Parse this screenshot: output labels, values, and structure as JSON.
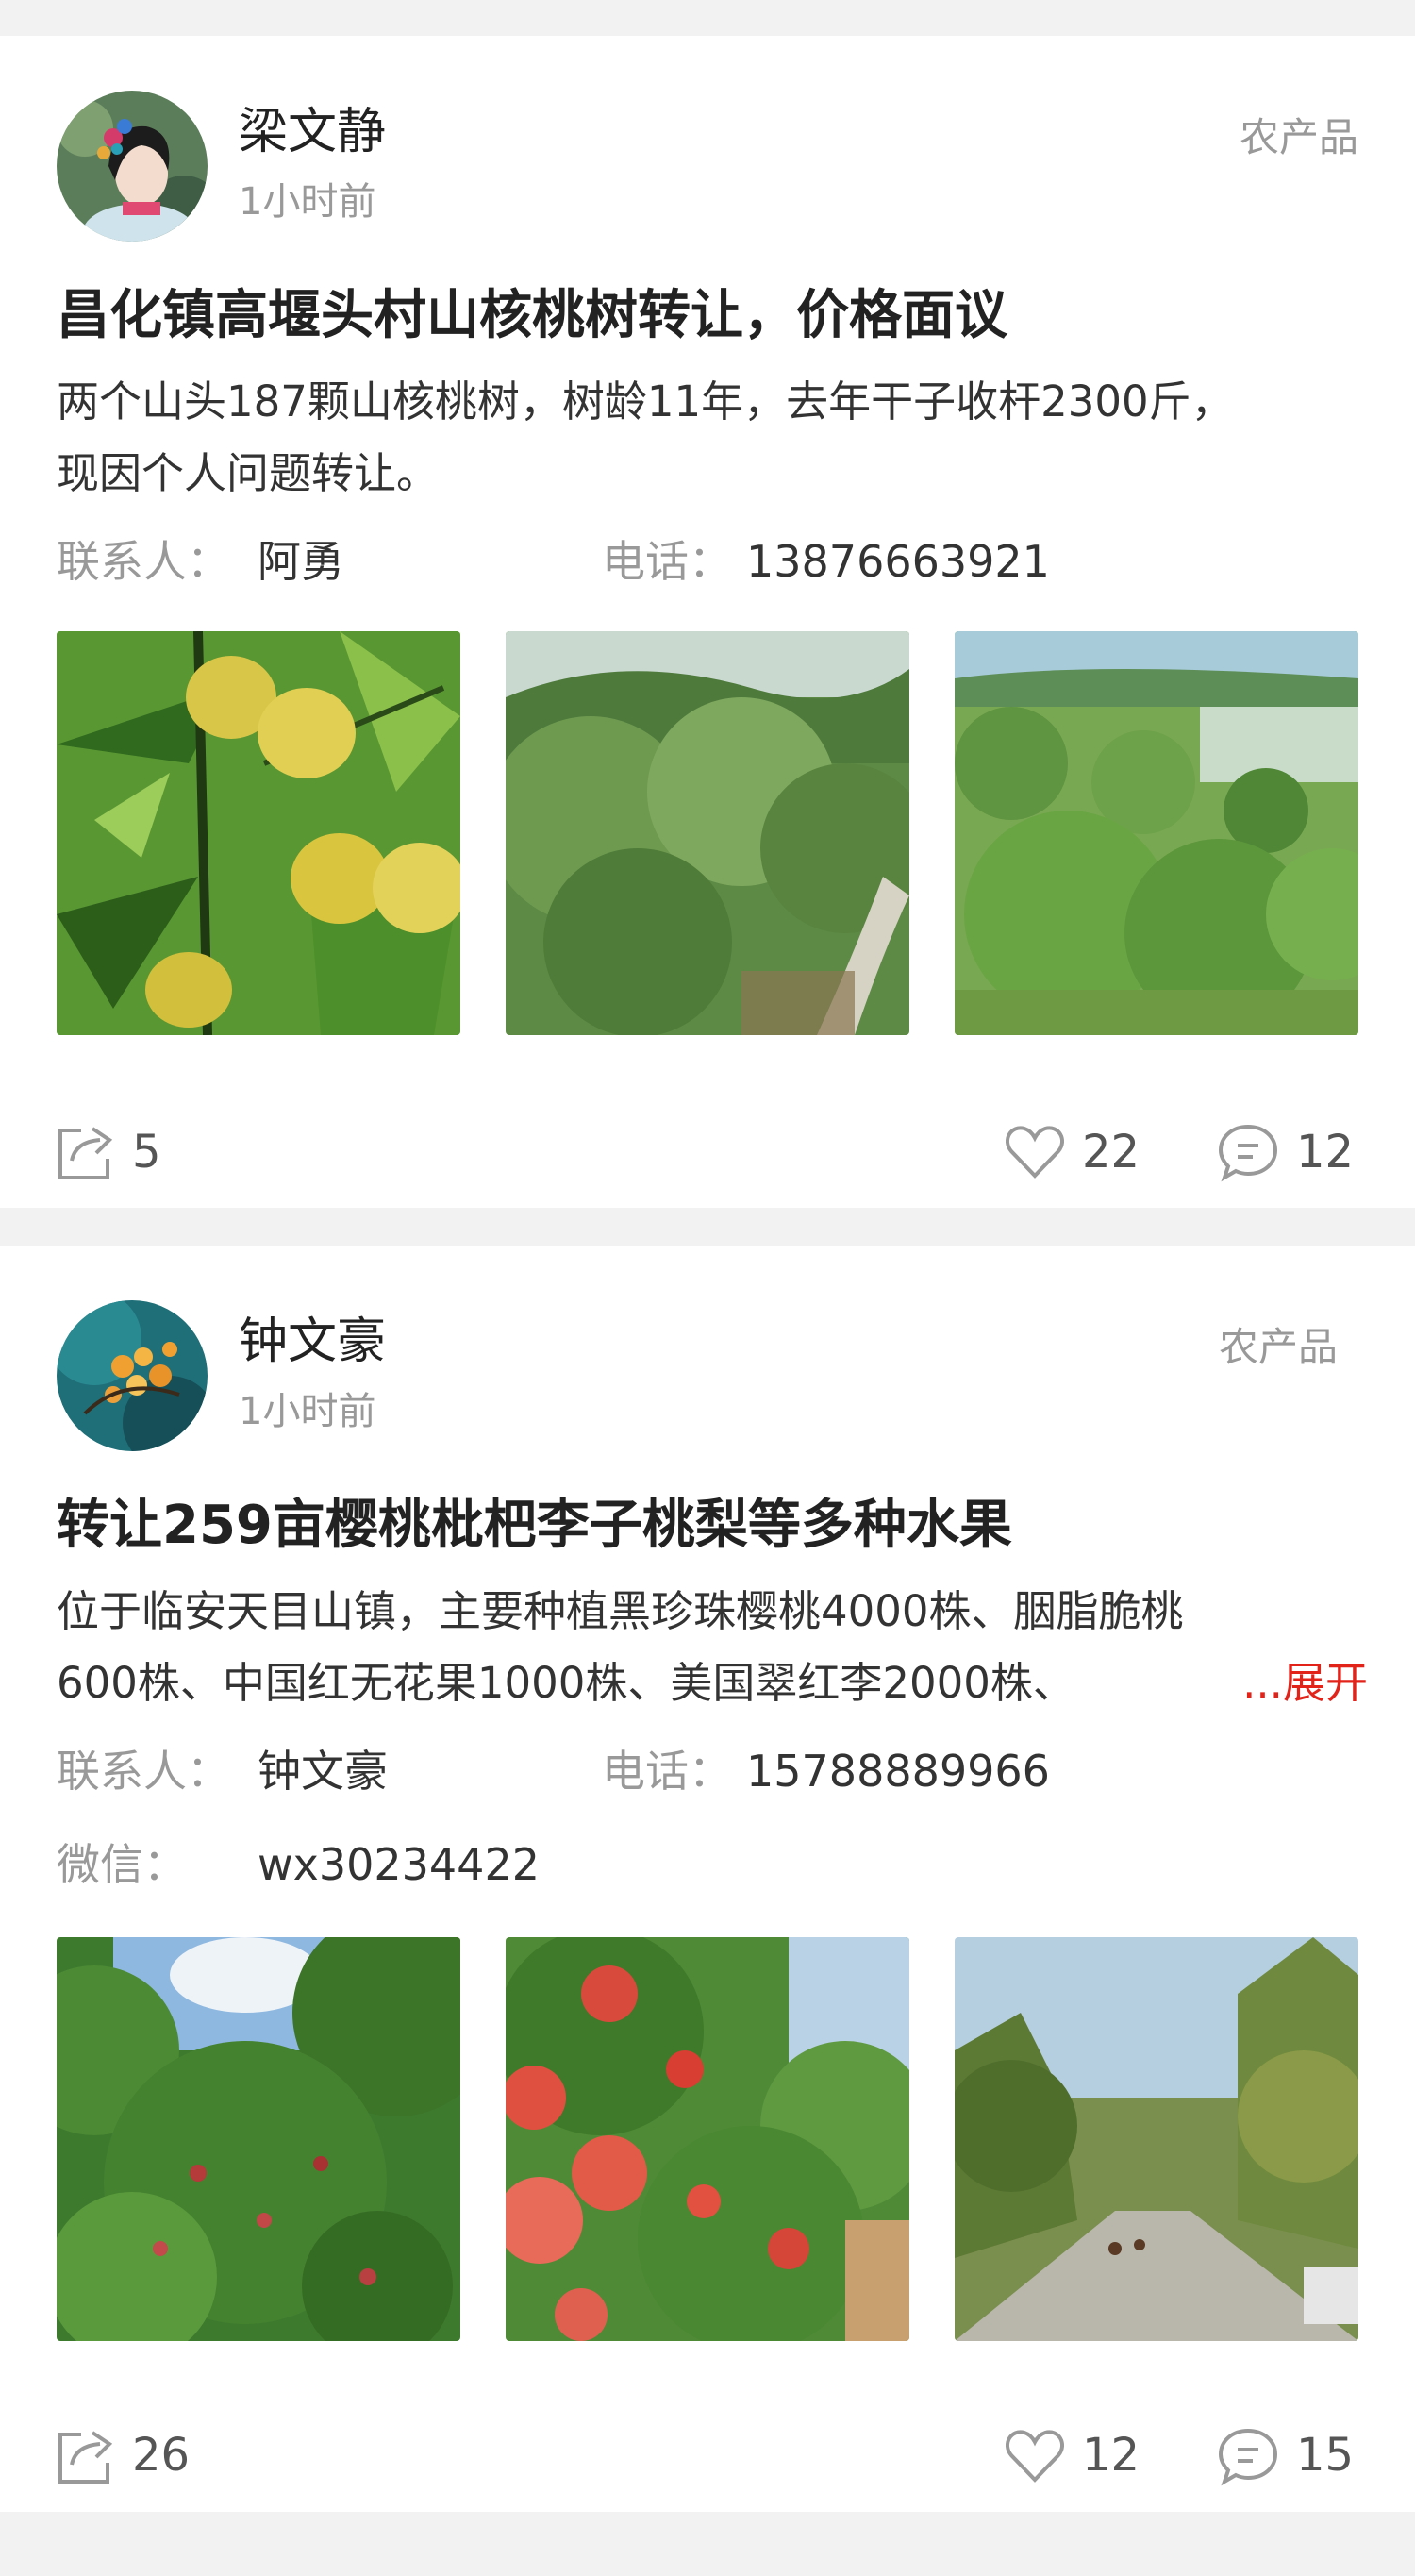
{
  "posts": [
    {
      "author": "梁文静",
      "time": "1小时前",
      "category": "农产品",
      "title": "昌化镇高堰头村山核桃树转让，价格面议",
      "description_lines": [
        "两个山头187颗山核桃树，树龄11年，去年干子收杆2300斤，",
        "现因个人问题转让。"
      ],
      "contact_label": "联系人：",
      "contact_name": "阿勇",
      "phone_label": "电话：",
      "phone": "13876663921",
      "shares": "5",
      "likes": "22",
      "comments": "12"
    },
    {
      "author": "钟文豪",
      "time": "1小时前",
      "category": "农产品",
      "title": "转让259亩樱桃枇杷李子桃梨等多种水果",
      "description_lines": [
        "位于临安天目山镇，主要种植黑珍珠樱桃4000株、胭脂脆桃",
        "600株、中国红无花果1000株、美国翠红李2000株、"
      ],
      "expand_label": "...展开",
      "contact_label": "联系人：",
      "contact_name": "钟文豪",
      "phone_label": "电话：",
      "phone": "15788889966",
      "wechat_label": "微信：",
      "wechat": "wx30234422",
      "shares": "26",
      "likes": "12",
      "comments": "15"
    }
  ],
  "icons": {
    "share": "share-icon",
    "like": "heart-icon",
    "comment": "comment-icon"
  },
  "colors": {
    "background": "#f2f2f2",
    "card": "#ffffff",
    "expand": "#e2231a",
    "muted": "#999999"
  }
}
